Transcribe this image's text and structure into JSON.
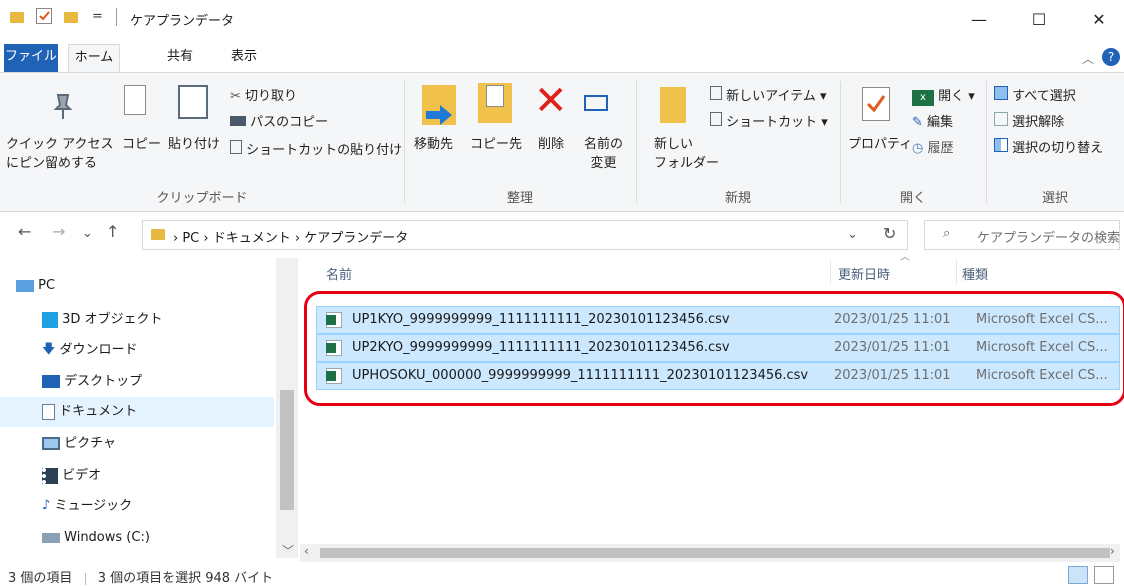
{
  "window": {
    "title": "ケアプランデータ",
    "minimize": "—",
    "maximize": "☐",
    "close": "✕",
    "quick_access_separator": "=",
    "help": "?"
  },
  "tabs": [
    "ファイル",
    "ホーム",
    "共有",
    "表示"
  ],
  "ribbon": {
    "clipboard": {
      "pin_label_1": "クイック アクセス",
      "pin_label_2": "にピン留めする",
      "copy": "コピー",
      "paste": "貼り付け",
      "cut": "切り取り",
      "copy_path": "パスのコピー",
      "paste_shortcut": "ショートカットの貼り付け",
      "group": "クリップボード"
    },
    "organize": {
      "move_to": "移動先",
      "copy_to": "コピー先",
      "delete": "削除",
      "rename_1": "名前の",
      "rename_2": "変更",
      "group": "整理"
    },
    "new": {
      "new_folder_1": "新しい",
      "new_folder_2": "フォルダー",
      "new_item": "新しいアイテム ▾",
      "shortcut": "ショートカット ▾",
      "group": "新規"
    },
    "open": {
      "properties": "プロパティ",
      "open": "開く ▾",
      "edit": "編集",
      "history": "履歴",
      "group": "開く"
    },
    "select": {
      "select_all": "すべて選択",
      "select_none": "選択解除",
      "invert": "選択の切り替え",
      "group": "選択"
    }
  },
  "address": {
    "back": "←",
    "forward": "→",
    "recent": "⌄",
    "up": "↑",
    "crumbs": [
      "PC",
      "ドキュメント",
      "ケアプランデータ"
    ],
    "crumb_sep": "›",
    "refresh": "↻",
    "dropdown": "⌄",
    "search_placeholder": "ケアプランデータの検索"
  },
  "nav": [
    {
      "label": "PC",
      "icon": "pc-icon"
    },
    {
      "label": "3D オブジェクト",
      "icon": "cube-icon"
    },
    {
      "label": "ダウンロード",
      "icon": "download-icon"
    },
    {
      "label": "デスクトップ",
      "icon": "desktop-icon"
    },
    {
      "label": "ドキュメント",
      "icon": "document-icon"
    },
    {
      "label": "ピクチャ",
      "icon": "picture-icon"
    },
    {
      "label": "ビデオ",
      "icon": "video-icon"
    },
    {
      "label": "ミュージック",
      "icon": "music-icon"
    },
    {
      "label": "Windows (C:)",
      "icon": "drive-icon"
    }
  ],
  "list": {
    "columns": [
      "名前",
      "更新日時",
      "種類"
    ],
    "rows": [
      {
        "name": "UP1KYO_9999999999_1111111111_20230101123456.csv",
        "date": "2023/01/25 11:01",
        "type": "Microsoft Excel CS..."
      },
      {
        "name": "UP2KYO_9999999999_1111111111_20230101123456.csv",
        "date": "2023/01/25 11:01",
        "type": "Microsoft Excel CS..."
      },
      {
        "name": "UPHOSOKU_000000_9999999999_1111111111_20230101123456.csv",
        "date": "2023/01/25 11:01",
        "type": "Microsoft Excel CS..."
      }
    ]
  },
  "status": {
    "count": "3 個の項目",
    "selected": "3 個の項目を選択 948 バイト"
  },
  "colors": {
    "accent": "#1f62b6",
    "selection": "#cce8ff",
    "highlight": "#e60012"
  }
}
